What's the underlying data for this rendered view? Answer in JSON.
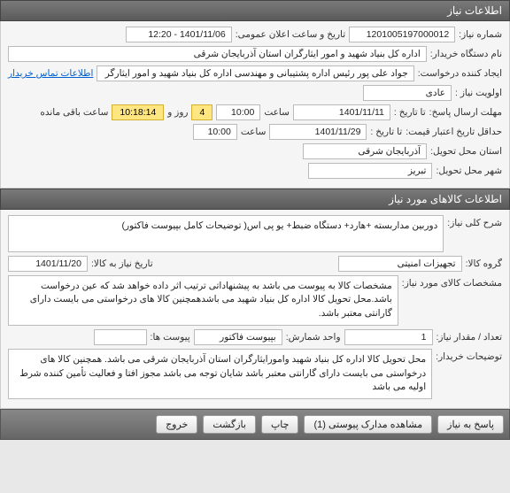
{
  "need_info": {
    "header": "اطلاعات نیاز",
    "labels": {
      "need_no": "شماره نیاز:",
      "announce_datetime": "تاریخ و ساعت اعلان عمومی:",
      "buyer_org": "نام دستگاه خریدار:",
      "requester": "ایجاد کننده درخواست:",
      "contact_link": "اطلاعات تماس خریدار",
      "priority": "اولویت نیاز :",
      "deadline_send": "مهلت ارسال پاسخ:",
      "to_date": "تا تاریخ :",
      "time": "ساعت",
      "days_and": "روز و",
      "remaining": "ساعت باقی مانده",
      "price_validity": "حداقل تاریخ اعتبار قیمت:",
      "delivery_province": "استان محل تحویل:",
      "delivery_city": "شهر محل تحویل:"
    },
    "values": {
      "need_no": "1201005197000012",
      "announce_datetime": "1401/11/06 - 12:20",
      "buyer_org": "اداره کل بنیاد شهید و امور ایثارگران استان آذربایجان شرقی",
      "requester": "جواد علی پور رئیس اداره پشتیبانی و مهندسی اداره کل بنیاد شهید و امور ایثارگر",
      "priority": "عادی",
      "deadline_date": "1401/11/11",
      "deadline_time": "10:00",
      "days_left": "4",
      "time_left": "10:18:14",
      "price_validity_date": "1401/11/29",
      "price_validity_time": "10:00",
      "province": "آذربایجان شرقی",
      "city": "تبریز"
    }
  },
  "goods_info": {
    "header": "اطلاعات کالاهای مورد نیاز",
    "labels": {
      "general_desc": "شرح کلی نیاز:",
      "goods_group": "گروه کالا:",
      "need_date": "تاریخ نیاز به کالا:",
      "goods_spec": "مشخصات کالای مورد نیاز:",
      "qty": "تعداد / مقدار نیاز:",
      "unit": "واحد شمارش:",
      "attachments": "پیوست ها:",
      "buyer_notes": "توضیحات خریدار:"
    },
    "values": {
      "general_desc": "دوربین مداربسته +هارد+ دستگاه ضبط+ یو پی اس( توضیحات کامل بپیوست فاکتور)",
      "goods_group": "تجهیزات امنیتی",
      "need_date": "1401/11/20",
      "goods_spec": "مشخصات کالا به پیوست می باشد به پیشنهاداتی ترتیب اثر داده خواهد شد که عین درخواست باشد.محل تحویل کالا اداره کل بنیاد شهید می باشدهمچنین کالا های درخواستی می بایست دارای گارانتی معتبر باشد.",
      "qty": "1",
      "unit": "بپیوست فاکتور",
      "attachments": "",
      "buyer_notes": "محل تحویل کالا اداره کل بنیاد شهید وامورایثارگران استان آذربایجان شرقی می باشد. همچنین کالا های درخواستی می بایست دارای گارانتی معتبر باشد شایان توجه می باشد مجوز افتا و فعالیت تأمین کننده شرط اولیه می باشد"
    }
  },
  "footer": {
    "respond": "پاسخ به نیاز",
    "attachments": "مشاهده مدارک پیوستی (1)",
    "print": "چاپ",
    "back": "بازگشت",
    "exit": "خروج"
  }
}
